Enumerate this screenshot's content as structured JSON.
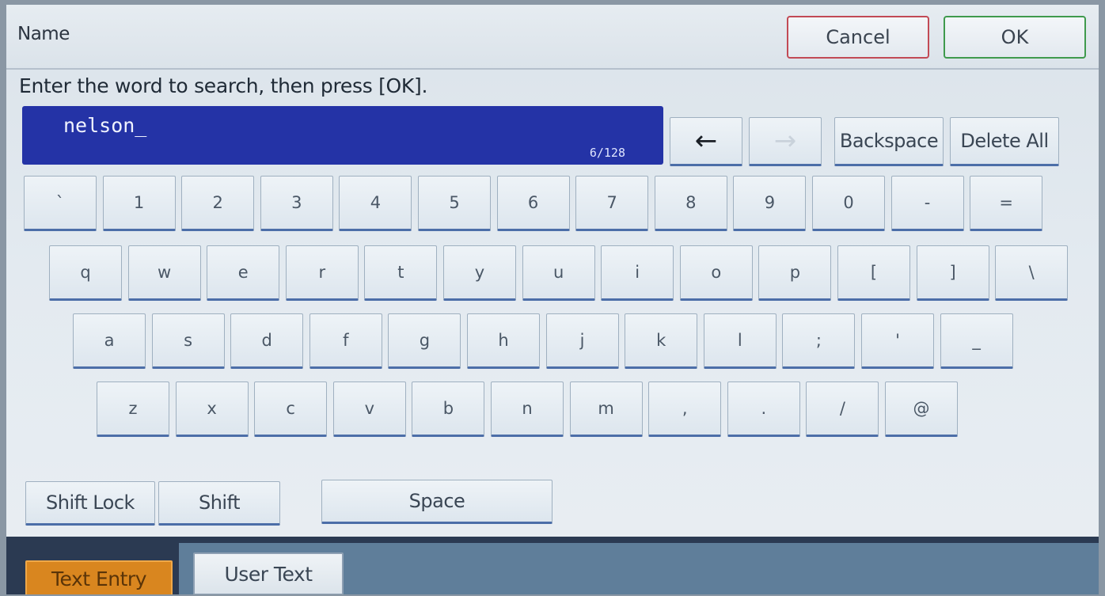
{
  "header": {
    "title": "Name",
    "cancel_label": "Cancel",
    "ok_label": "OK"
  },
  "instruction": "Enter the word to search, then press [OK].",
  "entry": {
    "value": "nelson_",
    "count": "6/128"
  },
  "controls": {
    "left_arrow": "←",
    "right_arrow": "→",
    "backspace": "Backspace",
    "delete_all": "Delete All"
  },
  "keyboard": {
    "row1": [
      "`",
      "1",
      "2",
      "3",
      "4",
      "5",
      "6",
      "7",
      "8",
      "9",
      "0",
      "-",
      "="
    ],
    "row2": [
      "q",
      "w",
      "e",
      "r",
      "t",
      "y",
      "u",
      "i",
      "o",
      "p",
      "[",
      "]",
      "\\"
    ],
    "row3": [
      "a",
      "s",
      "d",
      "f",
      "g",
      "h",
      "j",
      "k",
      "l",
      ";",
      "'",
      "_"
    ],
    "row4": [
      "z",
      "x",
      "c",
      "v",
      "b",
      "n",
      "m",
      ",",
      ".",
      "/",
      "@"
    ]
  },
  "modifiers": {
    "shift_lock": "Shift Lock",
    "shift": "Shift",
    "space": "Space"
  },
  "tabs": {
    "text_entry": "Text Entry",
    "user_text": "User Text"
  },
  "colors": {
    "entry_bg": "#2433a6",
    "active_tab": "#d9861f",
    "cancel_border": "#c24a55",
    "ok_border": "#3f9a4d"
  }
}
